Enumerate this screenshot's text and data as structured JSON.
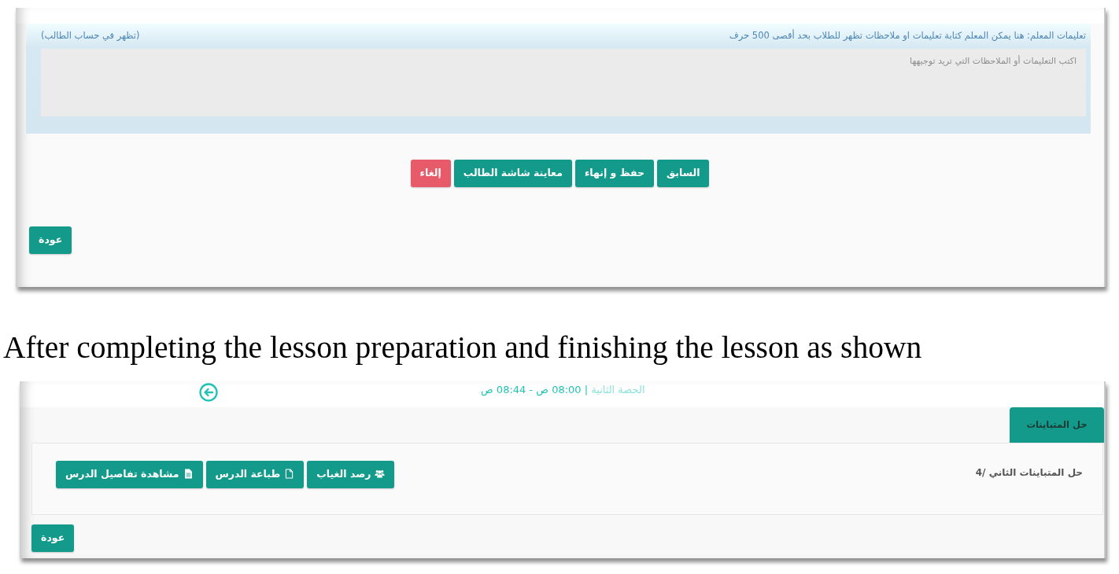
{
  "editor_panel": {
    "instructions_label": "تعليمات المعلم: هنا يمكن المعلم كتابة تعليمات او ملاحظات تظهر للطلاب بحد أقصى 500 حرف",
    "visibility_note": "(تظهر في حساب الطالب)",
    "notes_field": {
      "placeholder": "اكتب التعليمات أو الملاحظات التي تريد توجيهها"
    },
    "actions": [
      {
        "label": "السابق",
        "kind": "previous"
      },
      {
        "label": "حفظ و إنهاء",
        "kind": "save"
      },
      {
        "label": "معاينة شاشة الطالب",
        "kind": "preview"
      },
      {
        "label": "إلغاء",
        "kind": "cancel"
      }
    ],
    "back_button": "عودة"
  },
  "caption": "After completing the lesson preparation and finishing the lesson as shown",
  "lesson_panel": {
    "period": "الحصة الثانية",
    "time_range": "| 08:00 ص - 08:44 ص",
    "tabs": [
      {
        "label": "حل المتباينات",
        "selected": true
      }
    ],
    "lesson_title": "حل المتباينات الثاني /4",
    "actions": [
      {
        "label": "رصد الغياب",
        "kind": "attendance"
      },
      {
        "label": "طباعة الدرس",
        "kind": "print"
      },
      {
        "label": "مشاهدة تفاصيل الدرس",
        "kind": "details"
      }
    ],
    "back_button": "عودة"
  }
}
